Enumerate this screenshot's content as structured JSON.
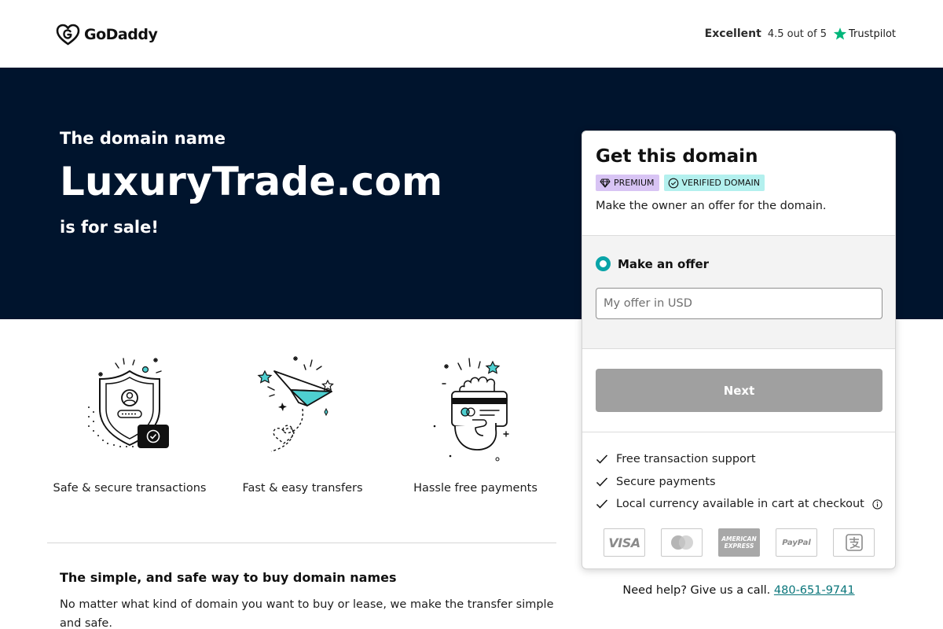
{
  "header": {
    "logo_text": "GoDaddy",
    "rating_label": "Excellent",
    "rating_score": "4.5 out of 5",
    "rating_brand": "Trustpilot",
    "star_icon": "star-icon",
    "trustpilot_color": "#00b67a"
  },
  "hero": {
    "intro": "The domain name",
    "domain": "LuxuryTrade.com",
    "status": "is for sale!",
    "background_color": "#00142d"
  },
  "features": [
    {
      "label": "Safe & secure transactions",
      "icon": "shield-icon"
    },
    {
      "label": "Fast & easy transfers",
      "icon": "paper-plane-icon"
    },
    {
      "label": "Hassle free payments",
      "icon": "hand-card-icon"
    }
  ],
  "info": {
    "title": "The simple, and safe way to buy domain names",
    "text": "No matter what kind of domain you want to buy or lease, we make the transfer simple and safe."
  },
  "card": {
    "title": "Get this domain",
    "badge_premium": "PREMIUM",
    "badge_verified": "VERIFIED DOMAIN",
    "subtitle": "Make the owner an offer for the domain.",
    "offer_option": "Make an offer",
    "offer_placeholder": "My offer in USD",
    "offer_value": "",
    "next_label": "Next",
    "benefits": [
      "Free transaction support",
      "Secure payments",
      "Local currency available in cart at checkout"
    ],
    "payment_methods": {
      "visa": "VISA",
      "mastercard": "mastercard-icon",
      "amex": "AMERICAN EXPRESS",
      "paypal": "PayPal",
      "alipay": "alipay-icon"
    },
    "accent_color": "#09a4a8",
    "premium_color": "#d8c4f4",
    "verified_color": "#b3f0ee"
  },
  "help": {
    "text": "Need help? Give us a call.",
    "phone": "480-651-9741"
  }
}
